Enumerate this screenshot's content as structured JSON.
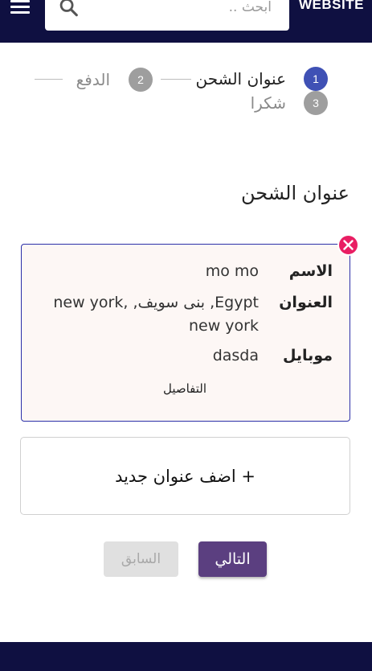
{
  "header": {
    "brand": "WEBSITE",
    "search": {
      "placeholder": "ابحث .."
    }
  },
  "stepper": {
    "steps": [
      {
        "number": "1",
        "label": "عنوان الشحن",
        "state": "active"
      },
      {
        "number": "2",
        "label": "الدفع",
        "state": "inactive"
      },
      {
        "number": "3",
        "label": "شكرا",
        "state": "inactive"
      }
    ]
  },
  "section_title": "عنوان الشحن",
  "address": {
    "name_label": "الاسم",
    "name_value": "mo mo",
    "address_label": "العنوان",
    "address_value": "Egypt, بنى سويف, new york, new york",
    "mobile_label": "موبايل",
    "mobile_value": "dasda",
    "details_label": "التفاصيل"
  },
  "new_address_label": "+ اضف عنوان جديد",
  "buttons": {
    "next": "التالي",
    "prev": "السابق"
  },
  "colors": {
    "header_bg": "#0f1041",
    "step_active": "#3f51b5",
    "step_inactive": "#9e9e9e",
    "primary_button": "#5b3f80",
    "remove": "#e91e63"
  }
}
